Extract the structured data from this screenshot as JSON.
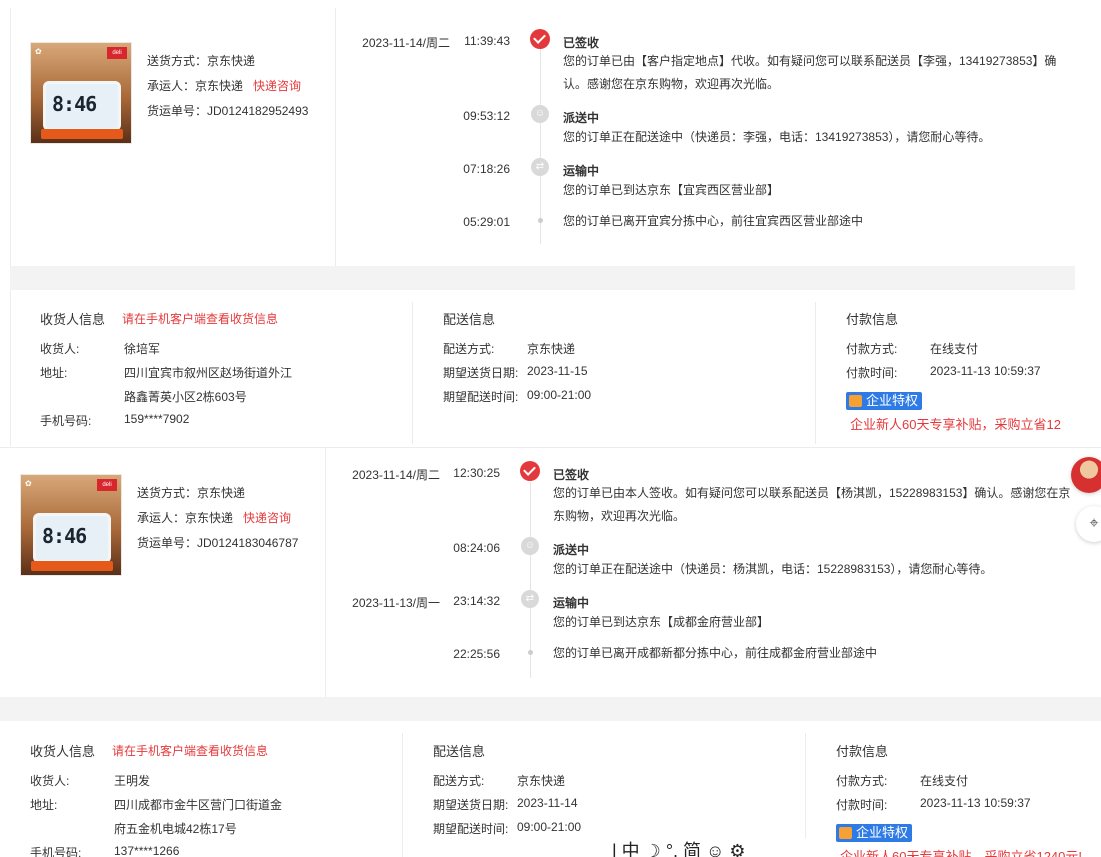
{
  "orders": [
    {
      "shipping": {
        "method_label": "送货方式：",
        "method": "京东快递",
        "carrier_label": "承运人：",
        "carrier": "京东快递",
        "consult": "快递咨询",
        "waybill_label": "货运单号：",
        "waybill": "JD0124182952493"
      },
      "timeline": [
        {
          "date": "2023-11-14/周二",
          "time": "11:39:43",
          "status": "已签收",
          "desc": "您的订单已由【客户指定地点】代收。如有疑问您可以联系配送员【李强，13419273853】确认。感谢您在京东购物，欢迎再次光临。"
        },
        {
          "date": "",
          "time": "09:53:12",
          "status": "派送中",
          "desc": "您的订单正在配送途中（快递员：李强，电话：13419273853），请您耐心等待。"
        },
        {
          "date": "",
          "time": "07:18:26",
          "status": "运输中",
          "desc": "您的订单已到达京东【宜宾西区营业部】"
        },
        {
          "date": "",
          "time": "05:29:01",
          "status": "",
          "desc": "您的订单已离开宜宾分拣中心，前往宜宾西区营业部途中"
        }
      ],
      "receiver": {
        "title": "收货人信息",
        "link": "请在手机客户端查看收货信息",
        "name_label": "收货人:",
        "name": "徐培军",
        "addr_label": "地址:",
        "addr1": "四川宜宾市叙州区赵场街道外江",
        "addr2": "路鑫菁英小区2栋603号",
        "phone_label": "手机号码:",
        "phone": "159****7902"
      },
      "delivery": {
        "title": "配送信息",
        "method_label": "配送方式:",
        "method": "京东快递",
        "date_label": "期望送货日期:",
        "date": "2023-11-15",
        "time_label": "期望配送时间:",
        "time": "09:00-21:00"
      },
      "payment": {
        "title": "付款信息",
        "method_label": "付款方式:",
        "method": "在线支付",
        "time_label": "付款时间:",
        "time": "2023-11-13 10:59:37",
        "badge": "企业特权",
        "promo": "企业新人60天专享补贴，采购立省12"
      }
    },
    {
      "shipping": {
        "method_label": "送货方式：",
        "method": "京东快递",
        "carrier_label": "承运人：",
        "carrier": "京东快递",
        "consult": "快递咨询",
        "waybill_label": "货运单号：",
        "waybill": "JD0124183046787"
      },
      "timeline": [
        {
          "date": "2023-11-14/周二",
          "time": "12:30:25",
          "status": "已签收",
          "desc": "您的订单已由本人签收。如有疑问您可以联系配送员【杨淇凯，15228983153】确认。感谢您在京东购物，欢迎再次光临。"
        },
        {
          "date": "",
          "time": "08:24:06",
          "status": "派送中",
          "desc": "您的订单正在配送途中（快递员：杨淇凯，电话：15228983153），请您耐心等待。"
        },
        {
          "date": "2023-11-13/周一",
          "time": "23:14:32",
          "status": "运输中",
          "desc": "您的订单已到达京东【成都金府营业部】"
        },
        {
          "date": "",
          "time": "22:25:56",
          "status": "",
          "desc": "您的订单已离开成都新都分拣中心，前往成都金府营业部途中"
        }
      ],
      "receiver": {
        "title": "收货人信息",
        "link": "请在手机客户端查看收货信息",
        "name_label": "收货人:",
        "name": "王明发",
        "addr_label": "地址:",
        "addr1": "四川成都市金牛区营门口街道金",
        "addr2": "府五金机电城42栋17号",
        "phone_label": "手机号码:",
        "phone": "137****1266"
      },
      "delivery": {
        "title": "配送信息",
        "method_label": "配送方式:",
        "method": "京东快递",
        "date_label": "期望送货日期:",
        "date": "2023-11-14",
        "time_label": "期望配送时间:",
        "time": "09:00-21:00"
      },
      "payment": {
        "title": "付款信息",
        "method_label": "付款方式:",
        "method": "在线支付",
        "time_label": "付款时间:",
        "time": "2023-11-13 10:59:37",
        "badge": "企业特权",
        "promo": "企业新人60天专享补贴，采购立省1240元!"
      }
    }
  ],
  "product": {
    "clock_time": "8:46"
  },
  "ime": {
    "chars": "| 中 ☽ °, 简 ☺ ⚙"
  },
  "colors": {
    "accent": "#e4393c",
    "badge": "#2e7be6",
    "band": "#f3f3f3"
  }
}
